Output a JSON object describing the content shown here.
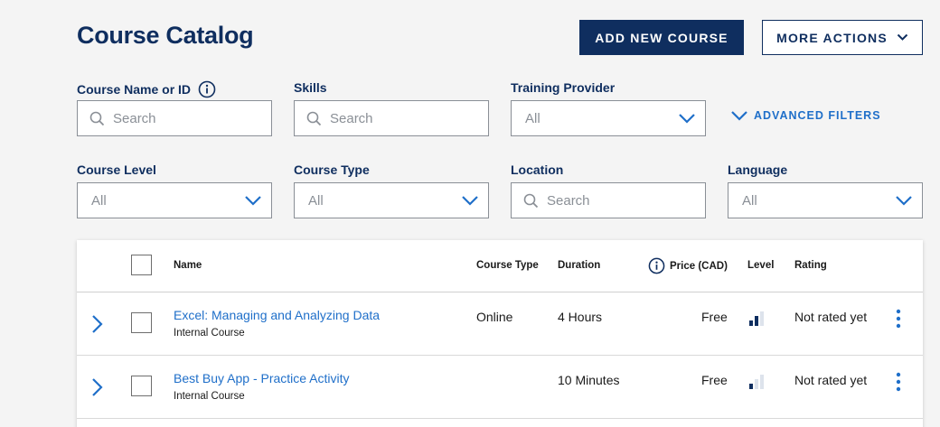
{
  "page_title": "Course Catalog",
  "actions": {
    "add_new_course": "ADD NEW COURSE",
    "more_actions": "MORE ACTIONS"
  },
  "filters": {
    "course_name": {
      "label": "Course Name or ID",
      "placeholder": "Search"
    },
    "skills": {
      "label": "Skills",
      "placeholder": "Search"
    },
    "training_provider": {
      "label": "Training Provider",
      "value": "All"
    },
    "advanced_filters": "ADVANCED FILTERS",
    "course_level": {
      "label": "Course Level",
      "value": "All"
    },
    "course_type": {
      "label": "Course Type",
      "value": "All"
    },
    "location": {
      "label": "Location",
      "placeholder": "Search"
    },
    "language": {
      "label": "Language",
      "value": "All"
    }
  },
  "table": {
    "columns": {
      "name": "Name",
      "course_type": "Course Type",
      "duration": "Duration",
      "price": "Price (CAD)",
      "level": "Level",
      "rating": "Rating"
    },
    "rows": [
      {
        "name": "Excel: Managing and Analyzing Data",
        "subtitle": "Internal Course",
        "course_type": "Online",
        "duration": "4 Hours",
        "price": "Free",
        "level_bars_filled": 2,
        "level_bars_total": 3,
        "rating": "Not rated yet"
      },
      {
        "name": "Best Buy App - Practice Activity",
        "subtitle": "Internal Course",
        "course_type": "",
        "duration": "10 Minutes",
        "price": "Free",
        "level_bars_filled": 1,
        "level_bars_total": 3,
        "rating": "Not rated yet"
      }
    ]
  },
  "colors": {
    "primary": "#0f2e5f",
    "link": "#1f6fc9",
    "background": "#f4f4f4"
  }
}
